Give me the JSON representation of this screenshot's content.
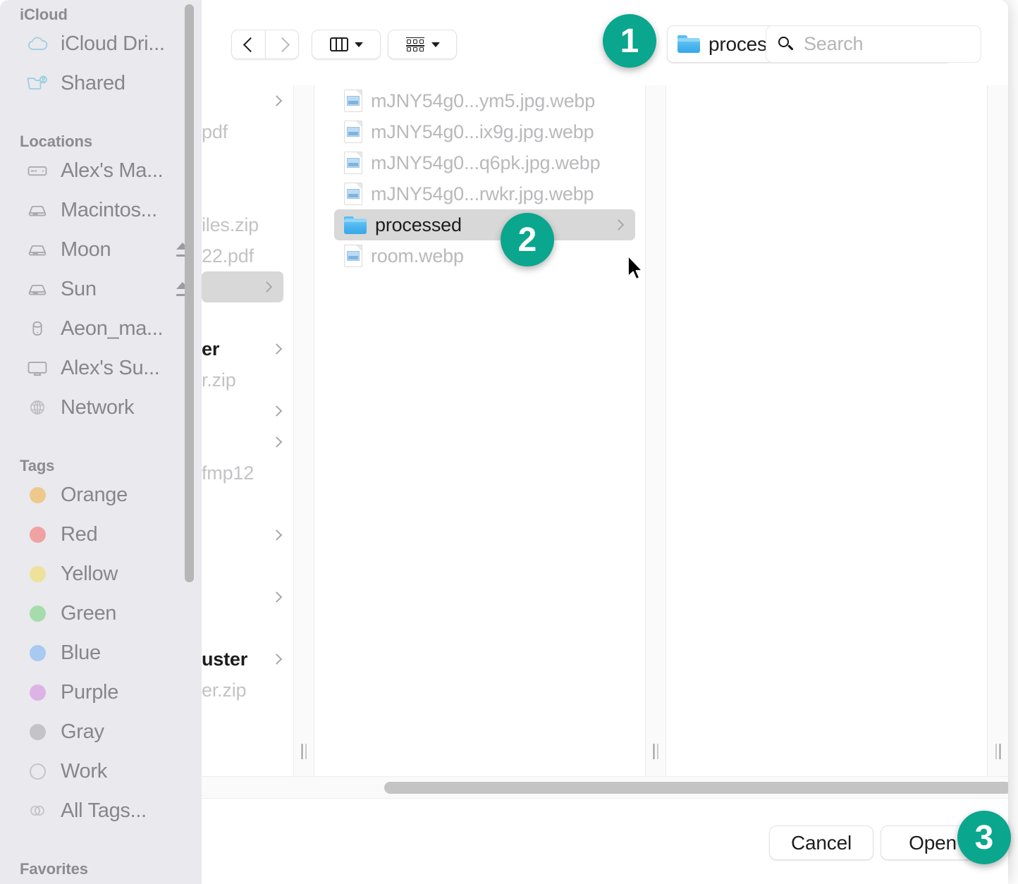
{
  "toolbar": {
    "back_icon": "chevron-left-icon",
    "forward_icon": "chevron-right-icon",
    "view_icon": "column-view-icon",
    "group_icon": "group-by-icon",
    "path_label": "processed",
    "path_folder_icon": "folder-icon",
    "stepper_icon": "up-down-arrows-icon",
    "search": {
      "icon": "search-icon",
      "placeholder": "Search",
      "value": ""
    }
  },
  "sidebar": {
    "sections": [
      {
        "header": "iCloud",
        "items": [
          {
            "label": "iCloud Dri...",
            "icon": "cloud-icon",
            "eject": false
          },
          {
            "label": "Shared",
            "icon": "shared-folder-icon",
            "eject": false
          }
        ]
      },
      {
        "header": "Locations",
        "items": [
          {
            "label": "Alex's Ma...",
            "icon": "laptop-icon",
            "eject": false
          },
          {
            "label": "Macintos...",
            "icon": "harddisk-icon",
            "eject": false
          },
          {
            "label": "Moon",
            "icon": "harddisk-icon",
            "eject": true
          },
          {
            "label": "Sun",
            "icon": "harddisk-icon",
            "eject": true
          },
          {
            "label": "Aeon_ma...",
            "icon": "external-drive-icon",
            "eject": false
          },
          {
            "label": "Alex's Su...",
            "icon": "display-icon",
            "eject": false
          },
          {
            "label": "Network",
            "icon": "globe-icon",
            "eject": false
          }
        ]
      },
      {
        "header": "Tags",
        "items": [
          {
            "label": "Orange",
            "icon": "tag-dot-icon",
            "color": "#efc88b"
          },
          {
            "label": "Red",
            "icon": "tag-dot-icon",
            "color": "#f0a2a2"
          },
          {
            "label": "Yellow",
            "icon": "tag-dot-icon",
            "color": "#eee29a"
          },
          {
            "label": "Green",
            "icon": "tag-dot-icon",
            "color": "#a6dcab"
          },
          {
            "label": "Blue",
            "icon": "tag-dot-icon",
            "color": "#a8c9f0"
          },
          {
            "label": "Purple",
            "icon": "tag-dot-icon",
            "color": "#ddb3e6"
          },
          {
            "label": "Gray",
            "icon": "tag-dot-icon",
            "color": "#c3c3c8"
          },
          {
            "label": "Work",
            "icon": "tag-ring-icon",
            "color": ""
          },
          {
            "label": "All Tags...",
            "icon": "all-tags-icon",
            "color": ""
          }
        ]
      },
      {
        "header": "Favorites",
        "items": []
      }
    ]
  },
  "browser": {
    "prev_column_rows": [
      {
        "text": "",
        "disclosure": true,
        "bold": false,
        "selected": false
      },
      {
        "text": "pdf",
        "disclosure": false,
        "bold": false,
        "selected": false
      },
      {
        "text": "",
        "disclosure": false,
        "bold": false,
        "selected": false
      },
      {
        "text": "",
        "disclosure": false,
        "bold": false,
        "selected": false
      },
      {
        "text": "iles.zip",
        "disclosure": false,
        "bold": false,
        "selected": false
      },
      {
        "text": "22.pdf",
        "disclosure": false,
        "bold": false,
        "selected": false
      },
      {
        "text": "",
        "disclosure": true,
        "bold": false,
        "selected": true
      },
      {
        "text": "",
        "disclosure": false,
        "bold": false,
        "selected": false
      },
      {
        "text": "er",
        "disclosure": true,
        "bold": true,
        "selected": false
      },
      {
        "text": "r.zip",
        "disclosure": false,
        "bold": false,
        "selected": false
      },
      {
        "text": "",
        "disclosure": true,
        "bold": false,
        "selected": false
      },
      {
        "text": "",
        "disclosure": true,
        "bold": false,
        "selected": false
      },
      {
        "text": "fmp12",
        "disclosure": false,
        "bold": false,
        "selected": false
      },
      {
        "text": "",
        "disclosure": false,
        "bold": false,
        "selected": false
      },
      {
        "text": "",
        "disclosure": true,
        "bold": false,
        "selected": false
      },
      {
        "text": "",
        "disclosure": false,
        "bold": false,
        "selected": false
      },
      {
        "text": "",
        "disclosure": true,
        "bold": false,
        "selected": false
      },
      {
        "text": "",
        "disclosure": false,
        "bold": false,
        "selected": false
      },
      {
        "text": "uster",
        "disclosure": true,
        "bold": true,
        "selected": false
      },
      {
        "text": "er.zip",
        "disclosure": false,
        "bold": false,
        "selected": false
      }
    ],
    "file_rows": [
      {
        "name": "mJNY54g0...ym5.jpg.webp",
        "icon": "image-document-icon",
        "selected": false,
        "disclosure": false
      },
      {
        "name": "mJNY54g0...ix9g.jpg.webp",
        "icon": "image-document-icon",
        "selected": false,
        "disclosure": false
      },
      {
        "name": "mJNY54g0...q6pk.jpg.webp",
        "icon": "image-document-icon",
        "selected": false,
        "disclosure": false
      },
      {
        "name": "mJNY54g0...rwkr.jpg.webp",
        "icon": "image-document-icon",
        "selected": false,
        "disclosure": false
      },
      {
        "name": "processed",
        "icon": "folder-icon",
        "selected": true,
        "disclosure": true
      },
      {
        "name": "room.webp",
        "icon": "image-document-icon",
        "selected": false,
        "disclosure": false
      }
    ]
  },
  "bottom_bar": {
    "cancel_label": "Cancel",
    "open_label": "Open"
  },
  "badges": [
    {
      "number": "1",
      "target": "path-popup"
    },
    {
      "number": "2",
      "target": "processed-folder-row"
    },
    {
      "number": "3",
      "target": "open-button"
    }
  ],
  "colors": {
    "badge": "#0aa68e",
    "selection": "#d8d8d8",
    "sidebar_bg": "#e9e9ee",
    "folder_blue": "#4bb4ee"
  }
}
